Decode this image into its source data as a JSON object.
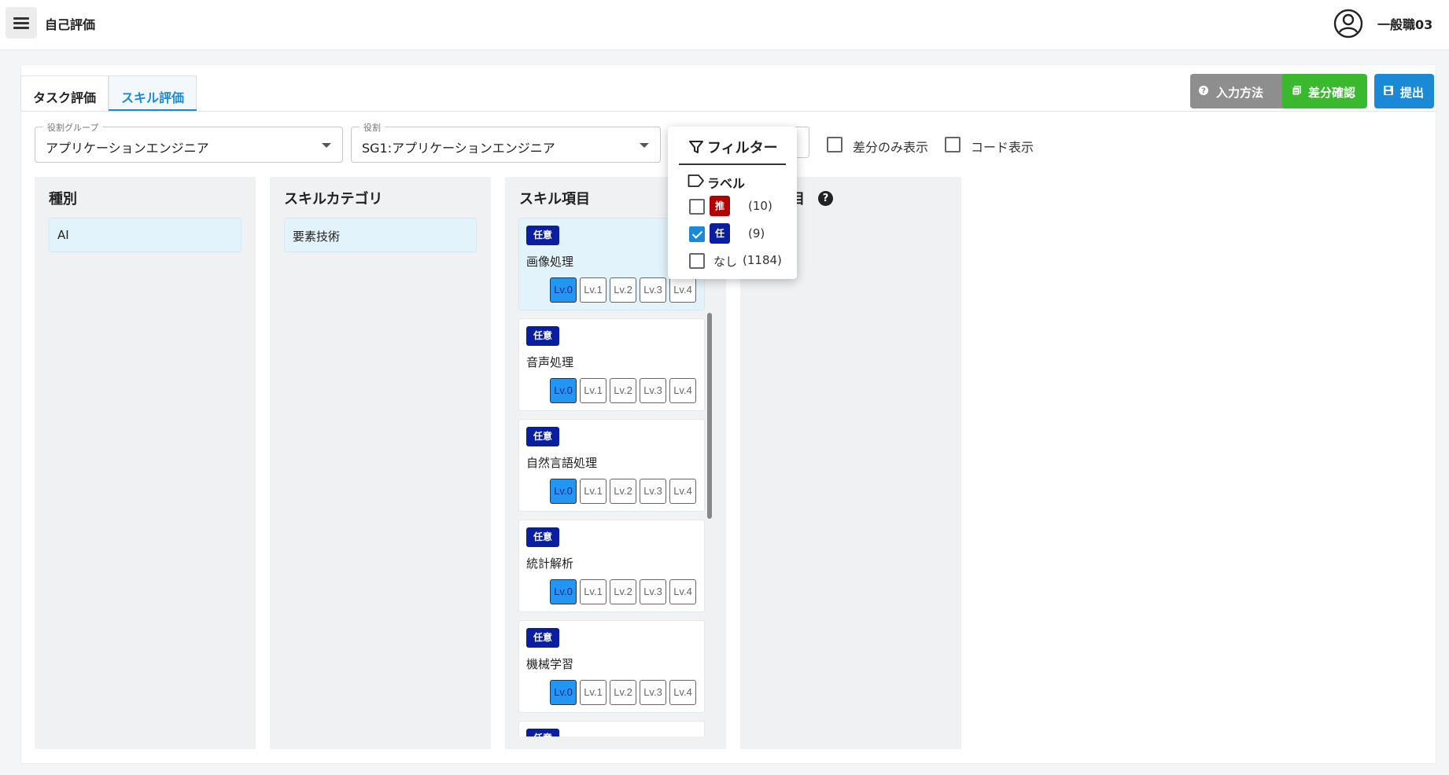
{
  "app": {
    "title": "自己評価",
    "user_name": "一般職03"
  },
  "tabs": [
    {
      "label": "タスク評価",
      "active": false
    },
    {
      "label": "スキル評価",
      "active": true
    }
  ],
  "actions": {
    "help": "入力方法",
    "diff": "差分確認",
    "submit": "提出"
  },
  "colors": {
    "accent": "#1a8ad6",
    "help": "#8e8e8e",
    "diff": "#3ab82e",
    "submit": "#1a8ad6",
    "tag_optional": "#0a1fa0",
    "tag_recommended": "#b00000"
  },
  "selects": {
    "role_group": {
      "label": "役割グループ",
      "value": "アプリケーションエンジニア"
    },
    "role": {
      "label": "役割",
      "value": "SG1:アプリケーションエンジニア"
    }
  },
  "checks": {
    "diff_only": "差分のみ表示",
    "code_display": "コード表示"
  },
  "columns": {
    "type": {
      "title": "種別",
      "items": [
        "AI"
      ]
    },
    "category": {
      "title": "スキルカテゴリ",
      "items": [
        "要素技術"
      ]
    },
    "skill": {
      "title": "スキル項目"
    },
    "detail": {
      "title_fragment": "目"
    }
  },
  "skills": [
    {
      "tag": "任意",
      "name": "画像処理",
      "level": "Lv.0",
      "selected": true
    },
    {
      "tag": "任意",
      "name": "音声処理",
      "level": "Lv.0",
      "selected": false
    },
    {
      "tag": "任意",
      "name": "自然言語処理",
      "level": "Lv.0",
      "selected": false
    },
    {
      "tag": "任意",
      "name": "統計解析",
      "level": "Lv.0",
      "selected": false
    },
    {
      "tag": "任意",
      "name": "機械学習",
      "level": "Lv.0",
      "selected": false
    },
    {
      "tag": "任意",
      "name": "",
      "level": "",
      "selected": false
    }
  ],
  "levels": [
    "Lv.0",
    "Lv.1",
    "Lv.2",
    "Lv.3",
    "Lv.4"
  ],
  "filter": {
    "title": "フィルター",
    "section": "ラベル",
    "options": [
      {
        "tag": "推奨",
        "count": "(10)",
        "checked": false
      },
      {
        "tag": "任意",
        "count": "(9)",
        "checked": true
      },
      {
        "tag": "",
        "label": "なし",
        "count": "(1184)",
        "checked": false
      }
    ]
  },
  "icons": [
    "menu-icon",
    "user-icon",
    "help-icon",
    "diff-icon",
    "save-icon",
    "chevron-down-icon",
    "filter-icon",
    "label-icon",
    "question-icon"
  ]
}
